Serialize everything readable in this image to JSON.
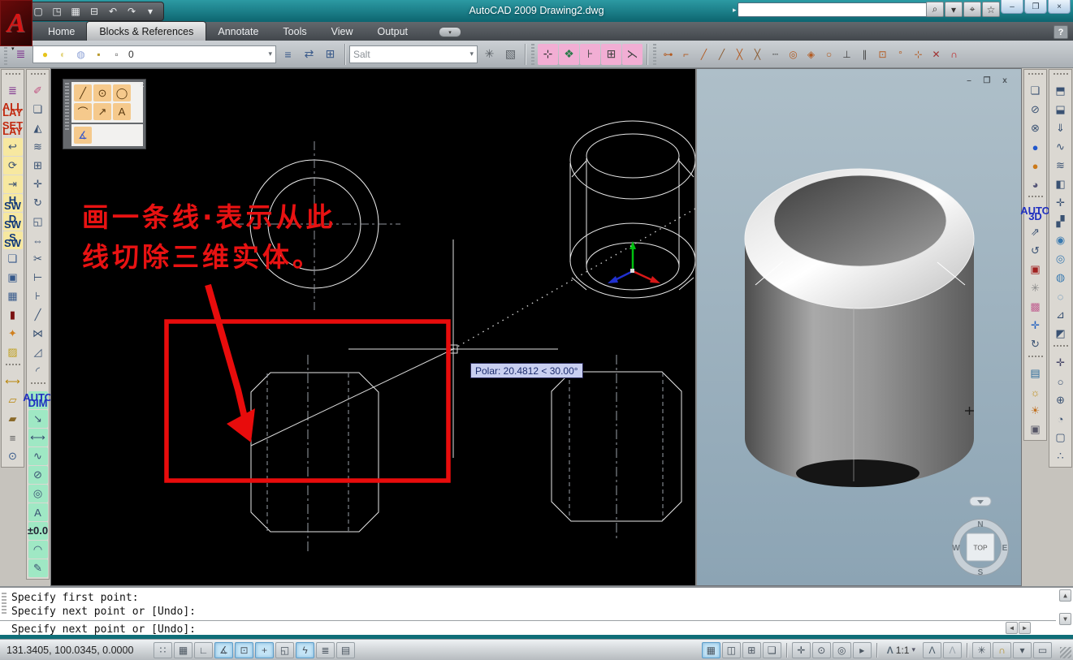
{
  "title_bar": {
    "title": "AutoCAD 2009 Drawing2.dwg",
    "arrow": "▸",
    "search_value": "",
    "qat": [
      {
        "name": "new-file-icon",
        "glyph": "▢"
      },
      {
        "name": "open-file-icon",
        "glyph": "◳"
      },
      {
        "name": "save-icon",
        "glyph": "▦"
      },
      {
        "name": "plot-icon",
        "glyph": "⊟"
      },
      {
        "name": "undo-icon",
        "glyph": "↶"
      },
      {
        "name": "redo-icon",
        "glyph": "↷"
      },
      {
        "name": "qat-menu-caret",
        "glyph": "▾"
      }
    ],
    "infocenter": [
      {
        "name": "search-icon",
        "glyph": "⌕"
      },
      {
        "name": "search-caret-icon",
        "glyph": "▾"
      },
      {
        "name": "comm-center-icon",
        "glyph": "⌖"
      },
      {
        "name": "favorites-star-icon",
        "glyph": "☆"
      }
    ],
    "window_buttons": [
      {
        "name": "minimize-button",
        "glyph": "–"
      },
      {
        "name": "maximize-button",
        "glyph": "❐"
      },
      {
        "name": "close-button",
        "glyph": "×"
      }
    ]
  },
  "logo": {
    "letter": "A",
    "caret": "▾"
  },
  "ribbon_tabs": [
    {
      "name": "tab-home",
      "label": "Home"
    },
    {
      "name": "tab-blocks-references",
      "label": "Blocks & References",
      "active": true
    },
    {
      "name": "tab-annotate",
      "label": "Annotate"
    },
    {
      "name": "tab-tools",
      "label": "Tools"
    },
    {
      "name": "tab-view",
      "label": "View"
    },
    {
      "name": "tab-output",
      "label": "Output"
    }
  ],
  "tab_overflow_caret": "▾",
  "help_label": "?",
  "toolbar2": {
    "layer_props_button": [
      {
        "name": "layer-properties-icon",
        "glyph": "≣",
        "fg": "#7a2a8a"
      }
    ],
    "layer_combo_icons": [
      {
        "name": "layer-on-bulb-icon",
        "glyph": "●",
        "fg": "#e6c41c"
      },
      {
        "name": "layer-freeze-icon",
        "glyph": "◐",
        "fg": "#e3d47e"
      },
      {
        "name": "layer-vp-icon",
        "glyph": "◍",
        "fg": "#8fa3d6"
      },
      {
        "name": "layer-lock-icon",
        "glyph": "▪",
        "fg": "#b99a2e"
      },
      {
        "name": "layer-color-chip",
        "glyph": "▫",
        "fg": "#555"
      }
    ],
    "layer_value": "0",
    "combo_caret": "▾",
    "layer_tools": [
      {
        "name": "layer-states-icon",
        "glyph": "≡",
        "fg": "#3a5a8a"
      },
      {
        "name": "layer-isolate-icon",
        "glyph": "⇄",
        "fg": "#3a5a8a"
      },
      {
        "name": "layer-settings-icon",
        "glyph": "⊞",
        "fg": "#3a5a8a"
      }
    ],
    "style_value": "Salt",
    "style_tools": [
      {
        "name": "gear-icon",
        "glyph": "✳",
        "fg": "#5a6066"
      },
      {
        "name": "boundary-icon",
        "glyph": "▧",
        "fg": "#5a6066"
      }
    ],
    "pink_group": [
      {
        "name": "point-marker-icon",
        "glyph": "⊹",
        "bg": "#f2aed4",
        "fg": "#333"
      },
      {
        "name": "block-group-icon",
        "glyph": "❖",
        "bg": "#f2aed4",
        "fg": "#2a7a4a"
      },
      {
        "name": "bolt-icon",
        "glyph": "⊦",
        "bg": "#f2aed4",
        "fg": "#444"
      },
      {
        "name": "table-cell-icon",
        "glyph": "⊞",
        "bg": "#f2aed4",
        "fg": "#444"
      },
      {
        "name": "break-line-icon",
        "glyph": "⋋",
        "bg": "#f2aed4",
        "fg": "#444"
      }
    ],
    "osnap_group": [
      {
        "name": "temp-track-icon",
        "glyph": "⊶",
        "fg": "#b35a20"
      },
      {
        "name": "snap-from-icon",
        "glyph": "⌐",
        "fg": "#b35a20"
      },
      {
        "name": "snap-endpoint-icon",
        "glyph": "╱",
        "fg": "#b35a20"
      },
      {
        "name": "snap-midpoint-icon",
        "glyph": "╱",
        "fg": "#8a5a30"
      },
      {
        "name": "snap-intersection-icon",
        "glyph": "╳",
        "fg": "#b35a20"
      },
      {
        "name": "snap-apparent-icon",
        "glyph": "╳",
        "fg": "#8a5a30"
      },
      {
        "name": "snap-extension-icon",
        "glyph": "┄",
        "fg": "#444"
      },
      {
        "name": "snap-center-icon",
        "glyph": "◎",
        "fg": "#b35a20"
      },
      {
        "name": "snap-quadrant-icon",
        "glyph": "◈",
        "fg": "#b35a20"
      },
      {
        "name": "snap-tangent-icon",
        "glyph": "○",
        "fg": "#b35a20"
      },
      {
        "name": "snap-perpendicular-icon",
        "glyph": "⊥",
        "fg": "#444"
      },
      {
        "name": "snap-parallel-icon",
        "glyph": "∥",
        "fg": "#444"
      },
      {
        "name": "snap-insert-icon",
        "glyph": "⊡",
        "fg": "#b35a20"
      },
      {
        "name": "snap-node-icon",
        "glyph": "°",
        "fg": "#b35a20"
      },
      {
        "name": "snap-nearest-icon",
        "glyph": "⊹",
        "fg": "#b35a20"
      },
      {
        "name": "snap-none-icon",
        "glyph": "✕",
        "fg": "#a03030"
      },
      {
        "name": "osnap-settings-magnet-icon",
        "glyph": "∩",
        "fg": "#c01212"
      }
    ]
  },
  "left_toolbar_a": [
    {
      "type": "grip"
    },
    {
      "name": "layers-palette-icon",
      "glyph": "≣",
      "fg": "#7a2a8a"
    },
    {
      "name": "all-lay-icon",
      "glyph": "ALL\nLAY",
      "cls": "txt",
      "fg": "#c22a10"
    },
    {
      "name": "set-lay-icon",
      "glyph": "SET\nLAY",
      "cls": "txt",
      "fg": "#c22a10"
    },
    {
      "name": "layer-previous-icon",
      "glyph": "↩",
      "bg": "#f7e8a0"
    },
    {
      "name": "layer-match-icon",
      "glyph": "⟳",
      "bg": "#f7e8a0"
    },
    {
      "name": "layer-isolate2-icon",
      "glyph": "⇥",
      "bg": "#f7e8a0"
    },
    {
      "name": "h-sw-icon",
      "glyph": "H\nSW",
      "cls": "txt",
      "bg": "#f7e8a0",
      "fg": "#123a7a"
    },
    {
      "name": "d-sw-icon",
      "glyph": "D\nSW",
      "cls": "txt",
      "bg": "#f7e8a0",
      "fg": "#123a7a"
    },
    {
      "name": "s-sw-icon",
      "glyph": "S\nSW",
      "cls": "txt",
      "bg": "#f7e8a0",
      "fg": "#123a7a"
    },
    {
      "name": "copy-layout-icon",
      "glyph": "❏",
      "fg": "#35588a"
    },
    {
      "name": "viewport-icon",
      "glyph": "▣",
      "fg": "#35588a"
    },
    {
      "name": "table-icon",
      "glyph": "▦",
      "fg": "#35588a"
    },
    {
      "name": "color-swatch-icon",
      "glyph": "▮",
      "fg": "#7a1010"
    },
    {
      "name": "paintbrush-icon",
      "glyph": "✦",
      "fg": "#d08020"
    },
    {
      "name": "gradient-swatch-icon",
      "glyph": "▨",
      "fg": "#c0a020"
    },
    {
      "type": "grip"
    },
    {
      "name": "measure-distance-icon",
      "glyph": "⟷",
      "fg": "#b8860b"
    },
    {
      "name": "measure-area-icon",
      "glyph": "▱",
      "fg": "#b8860b"
    },
    {
      "name": "region-mass-icon",
      "glyph": "▰",
      "fg": "#8a6a2a"
    },
    {
      "name": "list-info-icon",
      "glyph": "≡",
      "fg": "#555"
    },
    {
      "name": "id-point-icon",
      "glyph": "⊙",
      "fg": "#35588a"
    }
  ],
  "left_toolbar_b": [
    {
      "type": "grip"
    },
    {
      "name": "erase-icon",
      "glyph": "✐",
      "fg": "#c05080"
    },
    {
      "name": "copy-icon",
      "glyph": "❏"
    },
    {
      "name": "mirror-icon",
      "glyph": "◭"
    },
    {
      "name": "offset-icon",
      "glyph": "≋"
    },
    {
      "name": "array-icon",
      "glyph": "⊞"
    },
    {
      "name": "move-icon",
      "glyph": "✛"
    },
    {
      "name": "rotate-icon",
      "glyph": "↻"
    },
    {
      "name": "scale-icon",
      "glyph": "◱"
    },
    {
      "name": "stretch-icon",
      "glyph": "⇔"
    },
    {
      "name": "trim-icon",
      "glyph": "✂"
    },
    {
      "name": "extend-icon",
      "glyph": "⊢"
    },
    {
      "name": "break-point-icon",
      "glyph": "⊦"
    },
    {
      "name": "break-icon",
      "glyph": "╱"
    },
    {
      "name": "join-icon",
      "glyph": "⋈"
    },
    {
      "name": "chamfer-icon",
      "glyph": "◿"
    },
    {
      "name": "fillet-icon",
      "glyph": "◜"
    },
    {
      "type": "grip"
    },
    {
      "name": "auto-dim-icon",
      "glyph": "AUTO\nDIM",
      "cls": "txt",
      "bg": "#9fe8c4",
      "fg": "#2030c0"
    },
    {
      "name": "multileader-icon",
      "glyph": "↘",
      "bg": "#9fe8c4"
    },
    {
      "name": "linear-dim-icon",
      "glyph": "⟷",
      "bg": "#9fe8c4"
    },
    {
      "name": "jogged-dim-icon",
      "glyph": "∿",
      "bg": "#9fe8c4"
    },
    {
      "name": "radius-dim-icon",
      "glyph": "⊘",
      "bg": "#9fe8c4"
    },
    {
      "name": "dim-inspect-icon",
      "glyph": "◎",
      "bg": "#9fe8c4"
    },
    {
      "name": "dim-text-icon",
      "glyph": "A",
      "bg": "#9fe8c4"
    },
    {
      "name": "tolerance-icon",
      "glyph": "±0.0",
      "cls": "txt",
      "bg": "#9fe8c4",
      "fg": "#223"
    },
    {
      "name": "center-mark-icon",
      "glyph": "◠",
      "bg": "#9fe8c4"
    },
    {
      "name": "dim-edit-icon",
      "glyph": "✎",
      "bg": "#9fe8c4"
    }
  ],
  "right_toolbar_a": [
    {
      "type": "grip"
    },
    {
      "name": "draw-order-icon",
      "glyph": "❏"
    },
    {
      "name": "wipeout-icon",
      "glyph": "⊘"
    },
    {
      "name": "revision-cloud-icon",
      "glyph": "⊗"
    },
    {
      "name": "render-sphere-icon",
      "glyph": "●",
      "fg": "#2258cc"
    },
    {
      "name": "materials-sphere-icon",
      "glyph": "●",
      "fg": "#cc7a1a"
    },
    {
      "name": "material-mapping-icon",
      "glyph": "◕",
      "fg": "#557"
    },
    {
      "type": "grip"
    },
    {
      "name": "auto-3d-icon",
      "glyph": "AUTO\n3D",
      "cls": "txt",
      "fg": "#2030c0"
    },
    {
      "name": "orbit-box-icon",
      "glyph": "⇗"
    },
    {
      "name": "swivel-icon",
      "glyph": "↺"
    },
    {
      "name": "walk-box-icon",
      "glyph": "▣",
      "fg": "#a02020"
    },
    {
      "name": "ucs-tripod-icon",
      "glyph": "✳",
      "fg": "#888"
    },
    {
      "name": "palette-grid-icon",
      "glyph": "▩",
      "fg": "#c06090"
    },
    {
      "name": "pan-3d-icon",
      "glyph": "✛",
      "fg": "#2060c0"
    },
    {
      "name": "orbit-3d-icon",
      "glyph": "↻"
    },
    {
      "type": "grip"
    },
    {
      "name": "render-region-icon",
      "glyph": "▤",
      "fg": "#2a6a9a"
    },
    {
      "name": "lights-icon",
      "glyph": "☼",
      "fg": "#c09020"
    },
    {
      "name": "sun-properties-icon",
      "glyph": "☀",
      "fg": "#c07020"
    },
    {
      "name": "render-icon",
      "glyph": "▣",
      "fg": "#556"
    }
  ],
  "right_toolbar_b": [
    {
      "type": "grip"
    },
    {
      "name": "polysolid-icon",
      "glyph": "⬒"
    },
    {
      "name": "extrude-icon",
      "glyph": "⬓"
    },
    {
      "name": "presspull-icon",
      "glyph": "⇓"
    },
    {
      "name": "sweep-icon",
      "glyph": "∿"
    },
    {
      "name": "loft-icon",
      "glyph": "≋"
    },
    {
      "name": "visual-style-icon",
      "glyph": "◧"
    },
    {
      "name": "3d-move-icon",
      "glyph": "✛"
    },
    {
      "name": "slice-icon",
      "glyph": "▞"
    },
    {
      "name": "union-icon",
      "glyph": "◉",
      "fg": "#3a7ab0"
    },
    {
      "name": "subtract-icon",
      "glyph": "◎",
      "fg": "#3a7ab0"
    },
    {
      "name": "intersect-icon",
      "glyph": "◍",
      "fg": "#3a7ab0"
    },
    {
      "name": "interfere-icon",
      "glyph": "◌",
      "fg": "#3a7ab0"
    },
    {
      "name": "extract-edges-icon",
      "glyph": "⊿"
    },
    {
      "name": "3d-align-icon",
      "glyph": "◩"
    },
    {
      "type": "grip"
    },
    {
      "name": "pan-hand-icon",
      "glyph": "✛",
      "fg": "#446"
    },
    {
      "name": "orbit-icon",
      "glyph": "○"
    },
    {
      "name": "zoom-3d-icon",
      "glyph": "⊕"
    },
    {
      "name": "adjust-view-icon",
      "glyph": "◔"
    },
    {
      "name": "camera-icon",
      "glyph": "▢"
    },
    {
      "name": "walk-fly-icon",
      "glyph": "∴"
    }
  ],
  "float_palette": {
    "close": "x",
    "icons": [
      {
        "name": "line-tool-icon",
        "glyph": "╱"
      },
      {
        "name": "circle-tool-icon",
        "glyph": "⊙"
      },
      {
        "name": "ellipse-tool-icon",
        "glyph": "◯"
      },
      {
        "name": "arc-tool-icon",
        "glyph": "⌒"
      },
      {
        "name": "measure-tool-icon",
        "glyph": "↗"
      },
      {
        "name": "text-tool-icon",
        "glyph": "A"
      }
    ],
    "icons2": [
      {
        "name": "angle-tool-icon",
        "glyph": "∡",
        "fg": "#3355cc"
      }
    ]
  },
  "canvas": {
    "annotation": {
      "line1": "画一条线·表示从此",
      "line2": "线切除三维实体。"
    },
    "tooltip": "Polar: 20.4812 < 30.00°"
  },
  "viewport3d": {
    "window_buttons": [
      {
        "name": "vp-minimize-icon",
        "glyph": "–"
      },
      {
        "name": "vp-restore-icon",
        "glyph": "❐"
      },
      {
        "name": "vp-close-icon",
        "glyph": "x"
      }
    ],
    "viewcube": {
      "n": "N",
      "e": "E",
      "s": "S",
      "w": "W",
      "top": "TOP"
    }
  },
  "command": {
    "history": [
      {
        "name": "command-history-line",
        "label": "Specify first point:",
        "inter": false
      },
      {
        "name": "command-history-line",
        "label": "Specify next point or [Undo]:",
        "inter": false
      }
    ],
    "current": "Specify next point or [Undo]:",
    "scroll_up": "▲",
    "scroll_down": "▼",
    "scroll_left": "◀",
    "scroll_right": "▶"
  },
  "status": {
    "coords": "131.3405, 100.0345, 0.0000",
    "toggles": [
      {
        "name": "snap-toggle",
        "glyph": "∷"
      },
      {
        "name": "grid-toggle",
        "glyph": "▦"
      },
      {
        "name": "ortho-toggle",
        "glyph": "∟"
      },
      {
        "name": "polar-toggle",
        "glyph": "∡",
        "pressed": true
      },
      {
        "name": "osnap-toggle",
        "glyph": "⊡",
        "pressed": true
      },
      {
        "name": "otrack-toggle",
        "glyph": "+",
        "pressed": true
      },
      {
        "name": "ducs-toggle",
        "glyph": "◱"
      },
      {
        "name": "dyn-toggle",
        "glyph": "ϟ",
        "pressed": true
      },
      {
        "name": "lwt-toggle",
        "glyph": "≣"
      },
      {
        "name": "qp-toggle",
        "glyph": "▤"
      }
    ],
    "right_group_a": [
      {
        "name": "model-space-button",
        "glyph": "▦",
        "pressed": true
      },
      {
        "name": "layout-button",
        "glyph": "◫"
      },
      {
        "name": "quick-view-layouts-button",
        "glyph": "⊞"
      },
      {
        "name": "quick-view-drawings-button",
        "glyph": "❏"
      }
    ],
    "right_group_b": [
      {
        "name": "pan-button",
        "glyph": "✛"
      },
      {
        "name": "zoom-button",
        "glyph": "⊙"
      },
      {
        "name": "steering-wheel-button",
        "glyph": "◎"
      },
      {
        "name": "show-motion-button",
        "glyph": "▸"
      }
    ],
    "scale_icon": "Λ",
    "scale_label": "1:1",
    "scale_caret": "▾",
    "right_group_c": [
      {
        "name": "annotation-visibility-button",
        "glyph": "Λ",
        "fg": "#4a5a68"
      },
      {
        "name": "auto-annotate-button",
        "glyph": "Λ",
        "fg": "#9aa4ac"
      }
    ],
    "right_group_d": [
      {
        "name": "workspace-gear-button",
        "glyph": "✳"
      },
      {
        "name": "interface-lock-button",
        "glyph": "∩",
        "fg": "#b08818"
      },
      {
        "name": "status-menu-caret",
        "glyph": "▾"
      },
      {
        "name": "clean-screen-button",
        "glyph": "▭"
      }
    ]
  }
}
